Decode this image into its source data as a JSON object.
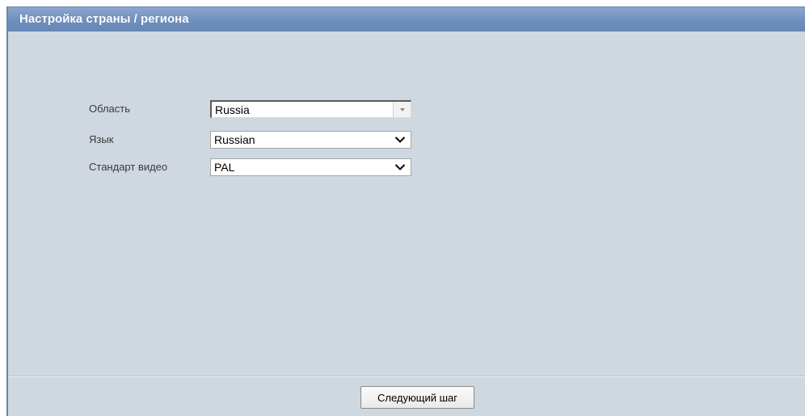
{
  "title_bar": {
    "title": "Настройка страны / региона",
    "background_color": "#7593c0",
    "text_color": "#ffffff"
  },
  "panel": {
    "background_color": "#cfd7e0"
  },
  "form": {
    "region": {
      "label": "Область",
      "value": "Russia",
      "control": "combo-box"
    },
    "language": {
      "label": "Язык",
      "value": "Russian",
      "control": "dropdown"
    },
    "video_standard": {
      "label": "Стандарт видео",
      "value": "PAL",
      "control": "dropdown"
    }
  },
  "footer": {
    "next_button_label": "Следующий шаг"
  },
  "icons": {
    "combo_arrow": "triangle-down-icon",
    "dropdown_arrow": "chevron-down-icon"
  }
}
